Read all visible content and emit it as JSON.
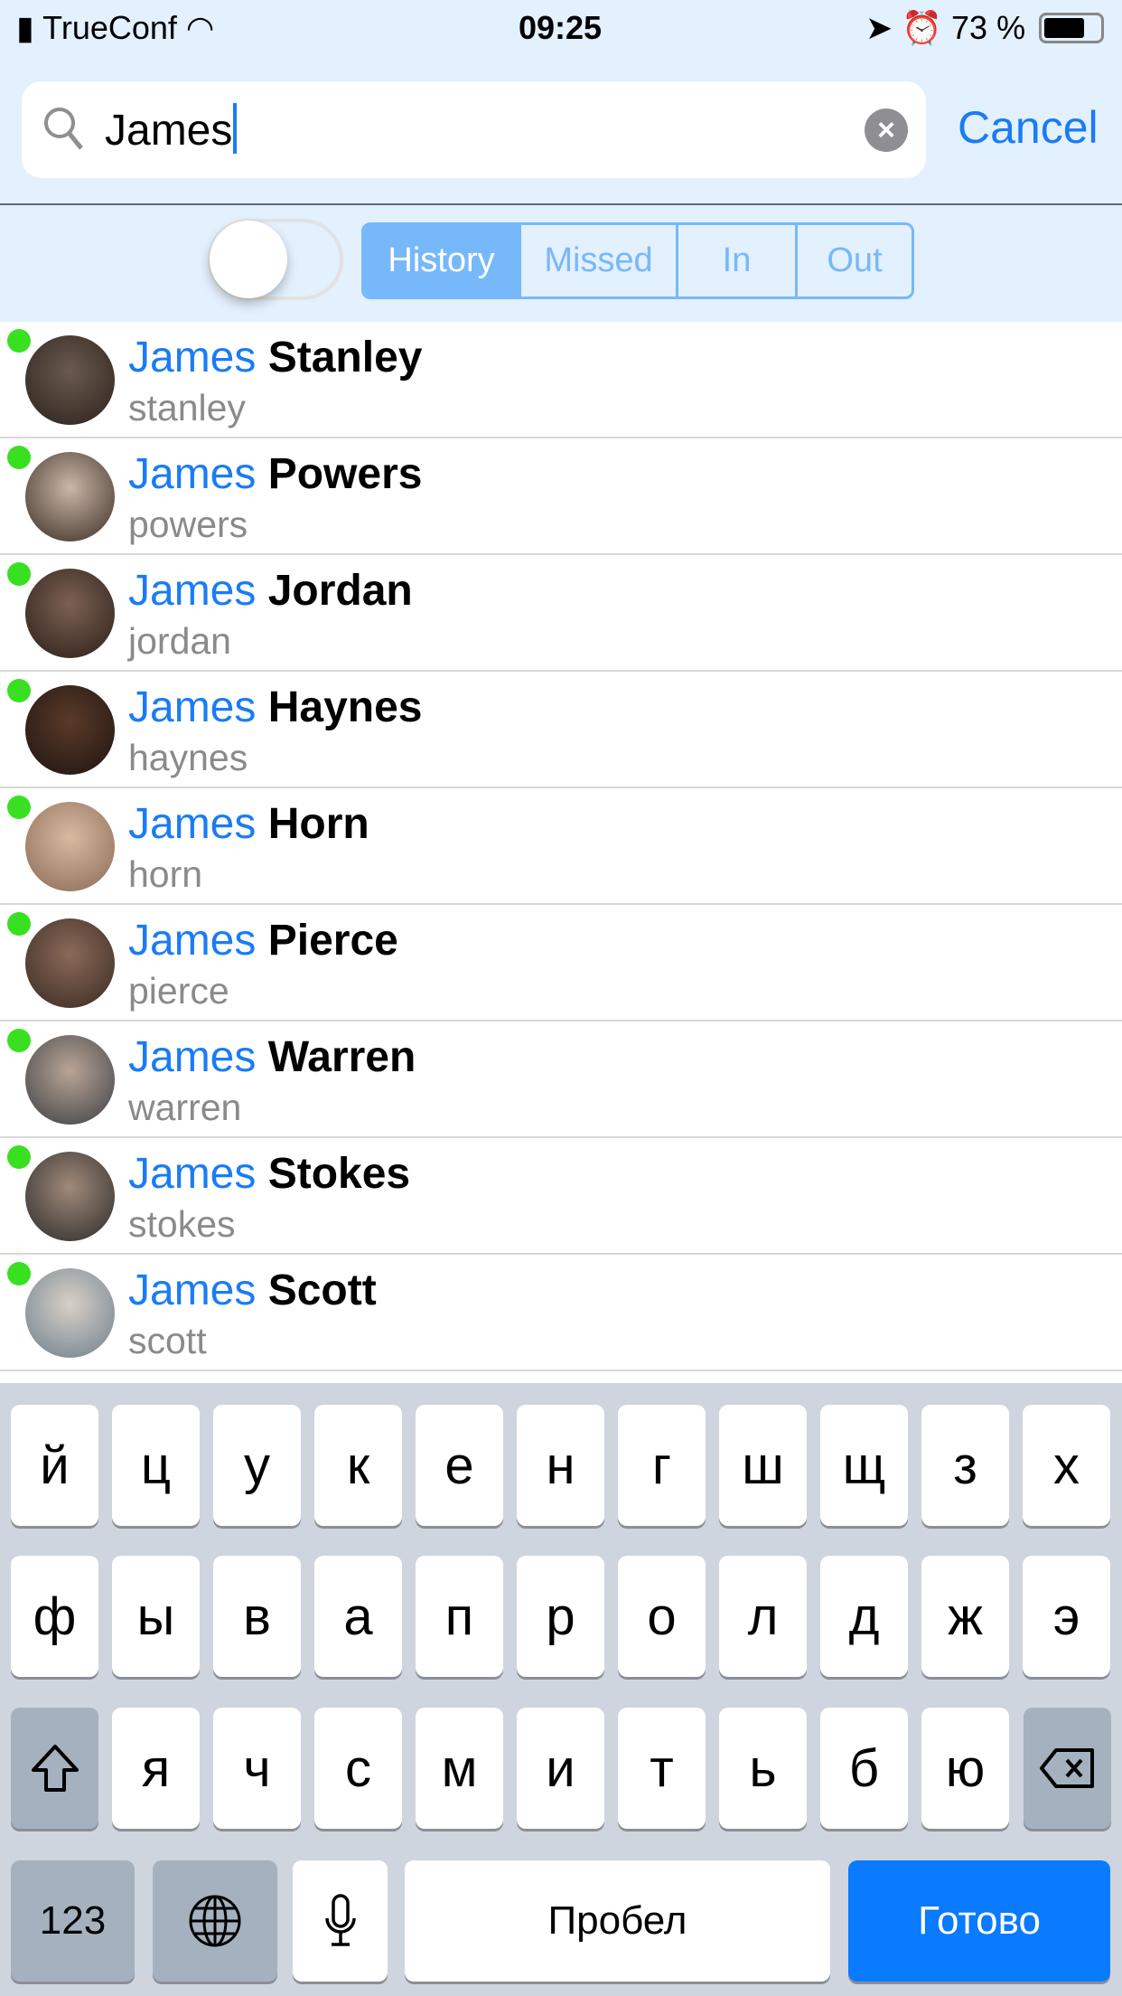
{
  "status_bar": {
    "carrier": "TrueConf",
    "time": "09:25",
    "battery": "73 %",
    "icons": [
      "signal-icon",
      "wifi-icon",
      "location-icon",
      "alarm-icon",
      "battery-icon"
    ]
  },
  "search": {
    "value": "James",
    "cancel_label": "Cancel"
  },
  "filter": {
    "toggle_on": false,
    "segments": [
      "History",
      "Missed",
      "In",
      "Out"
    ],
    "selected": "History"
  },
  "colors": {
    "accent": "#1a7cf5",
    "online": "#39e021",
    "segment": "#77b8fb"
  },
  "contacts": [
    {
      "first": "James",
      "last": "Stanley",
      "username": "stanley"
    },
    {
      "first": "James",
      "last": "Powers",
      "username": "powers"
    },
    {
      "first": "James",
      "last": "Jordan",
      "username": "jordan"
    },
    {
      "first": "James",
      "last": "Haynes",
      "username": "haynes"
    },
    {
      "first": "James",
      "last": "Horn",
      "username": "horn"
    },
    {
      "first": "James",
      "last": "Pierce",
      "username": "pierce"
    },
    {
      "first": "James",
      "last": "Warren",
      "username": "warren"
    },
    {
      "first": "James",
      "last": "Stokes",
      "username": "stokes"
    },
    {
      "first": "James",
      "last": "Scott",
      "username": "scott"
    }
  ],
  "keyboard": {
    "row1": [
      "й",
      "ц",
      "у",
      "к",
      "е",
      "н",
      "г",
      "ш",
      "щ",
      "з",
      "х"
    ],
    "row2": [
      "ф",
      "ы",
      "в",
      "а",
      "п",
      "р",
      "о",
      "л",
      "д",
      "ж",
      "э"
    ],
    "row3": [
      "я",
      "ч",
      "с",
      "м",
      "и",
      "т",
      "ь",
      "б",
      "ю"
    ],
    "numbers": "123",
    "space": "Пробел",
    "done": "Готово"
  }
}
